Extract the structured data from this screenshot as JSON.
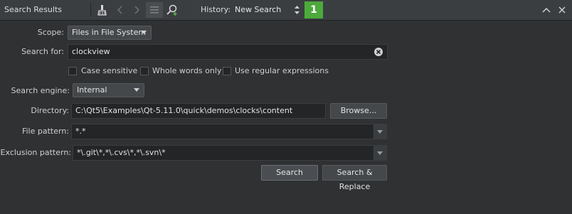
{
  "header": {
    "title": "Search Results",
    "history_label": "History:",
    "history_value": "New Search",
    "badge_count": "1",
    "icons": [
      "clean-brush-icon",
      "back-arrow-icon",
      "forward-arrow-icon",
      "list-icon",
      "new-search-icon",
      "collapse-icon",
      "close-icon"
    ]
  },
  "form": {
    "scope_label": "Scope:",
    "scope_value": "Files in File System",
    "search_for_label": "Search for:",
    "search_for_value": "clockview",
    "options": [
      {
        "label": "Case sensitive",
        "checked": false
      },
      {
        "label": "Whole words only",
        "checked": false
      },
      {
        "label": "Use regular expressions",
        "checked": false
      }
    ],
    "engine_label": "Search engine:",
    "engine_value": "Internal",
    "directory_label": "Directory:",
    "directory_value": "C:\\Qt5\\Examples\\Qt-5.11.0\\quick\\demos\\clocks\\content",
    "browse_label": "Browse...",
    "file_pattern_label": "File pattern:",
    "file_pattern_value": "*.*",
    "exclusion_label": "Exclusion pattern:",
    "exclusion_value": "*\\.git\\*,*\\.cvs\\*,*\\.svn\\*",
    "search_label": "Search",
    "search_replace_label": "Search & Replace"
  },
  "colors": {
    "badge": "#4caa3c",
    "background": "#2f3133",
    "toolbar": "#3b3e41"
  }
}
